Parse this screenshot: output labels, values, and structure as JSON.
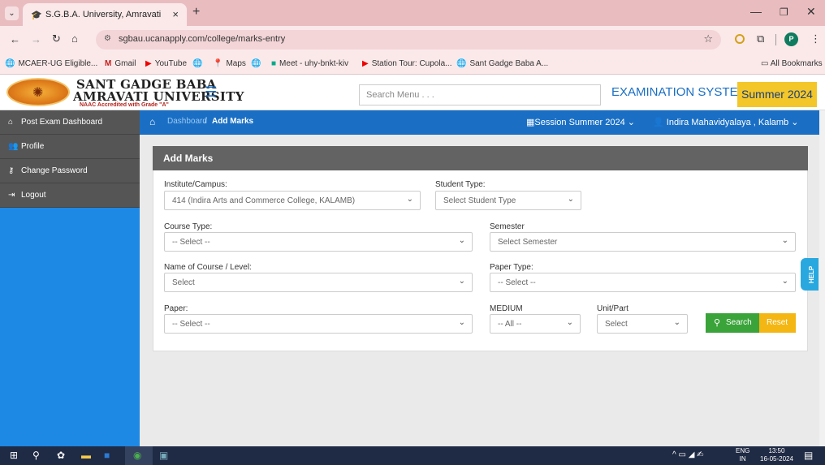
{
  "browser": {
    "tab_title": "S.G.B.A. University, Amravati",
    "url": "sgbau.ucanapply.com/college/marks-entry",
    "profile_initial": "P",
    "bookmarks": [
      {
        "label": "MCAER-UG Eligible...",
        "icon": "globe-icon"
      },
      {
        "label": "Gmail",
        "icon": "gmail-icon"
      },
      {
        "label": "YouTube",
        "icon": "youtube-icon"
      },
      {
        "label": "",
        "icon": "globe-icon"
      },
      {
        "label": "Maps",
        "icon": "maps-icon"
      },
      {
        "label": "",
        "icon": "globe-icon"
      },
      {
        "label": "Meet - uhy-bnkt-kiv",
        "icon": "meet-icon"
      },
      {
        "label": "Station Tour: Cupola...",
        "icon": "youtube-icon"
      },
      {
        "label": "Sant Gadge Baba A...",
        "icon": "globe-icon"
      }
    ],
    "all_bookmarks": "All Bookmarks"
  },
  "header": {
    "univ_line1": "SANT GADGE BABA",
    "univ_line2": "AMRAVATI UNIVERSITY",
    "univ_line3": "NAAC Accredited with Grade \"A\"",
    "search_placeholder": "Search Menu . . .",
    "system_title": "EXAMINATION SYSTEM",
    "session_badge": "Summer 2024"
  },
  "sidebar": {
    "items": [
      {
        "label": "Post Exam Dashboard",
        "icon": "home-icon"
      },
      {
        "label": "Profile",
        "icon": "users-icon"
      },
      {
        "label": "Change Password",
        "icon": "key-icon"
      },
      {
        "label": "Logout",
        "icon": "logout-icon"
      }
    ]
  },
  "breadcrumb": {
    "dashboard": "Dashboard",
    "separator": "/",
    "current": "Add Marks",
    "session": "Session Summer 2024",
    "college": "Indira Mahavidyalaya , Kalamb"
  },
  "form": {
    "title": "Add Marks",
    "institute_label": "Institute/Campus:",
    "institute_value": "414 (Indira Arts and Commerce College, KALAMB)",
    "student_type_label": "Student Type:",
    "student_type_value": "Select Student Type",
    "course_type_label": "Course Type:",
    "course_type_value": "-- Select --",
    "semester_label": "Semester",
    "semester_value": "Select Semester",
    "course_name_label": "Name of Course / Level:",
    "course_name_value": "Select",
    "paper_type_label": "Paper Type:",
    "paper_type_value": "-- Select --",
    "paper_label": "Paper:",
    "paper_value": "-- Select --",
    "medium_label": "MEDIUM",
    "medium_value": "-- All --",
    "unit_label": "Unit/Part",
    "unit_value": "Select",
    "search_button": "Search",
    "reset_button": "Reset"
  },
  "help_label": "HELP",
  "taskbar": {
    "lang_line1": "ENG",
    "lang_line2": "IN",
    "time": "13:50",
    "date": "16-05-2024"
  },
  "colors": {
    "primary_blue": "#1a6fc4",
    "sidebar_blue": "#1e88e5",
    "sidebar_item": "#555555",
    "badge_yellow": "#f3c629",
    "search_green": "#3aa33a",
    "reset_orange": "#f3b613",
    "panel_header": "#636363"
  }
}
